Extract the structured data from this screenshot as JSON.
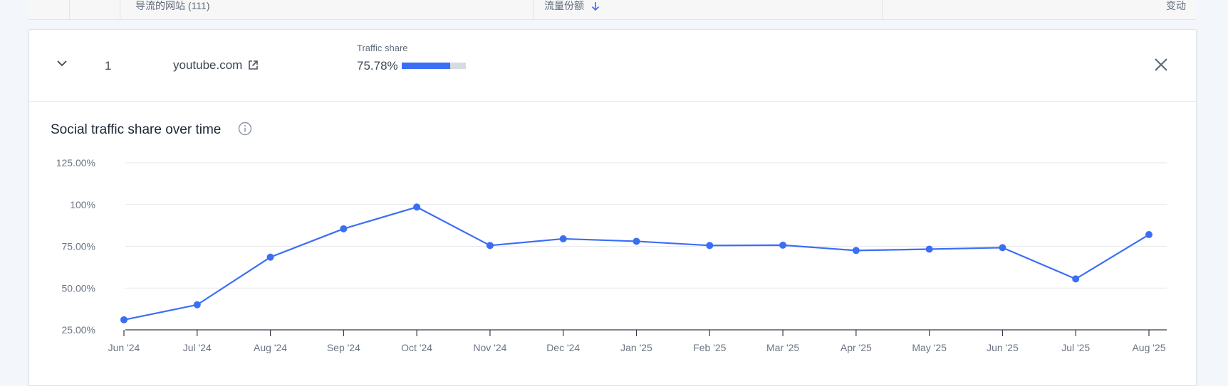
{
  "header": {
    "col_sites": "导流的网站 (111)",
    "col_share": "流量份额",
    "col_change": "变动"
  },
  "row": {
    "rank": "1",
    "domain": "youtube.com",
    "traffic_share_label": "Traffic share",
    "traffic_share_value": "75.78%",
    "traffic_share_fraction": 0.7578
  },
  "colors": {
    "accent": "#3b6ef6",
    "bar_track": "#d7dce3"
  },
  "chart_data": {
    "type": "line",
    "title": "Social traffic share over time",
    "categories": [
      "Jun '24",
      "Jul '24",
      "Aug '24",
      "Sep '24",
      "Oct '24",
      "Nov '24",
      "Dec '24",
      "Jan '25",
      "Feb '25",
      "Mar '25",
      "Apr '25",
      "May '25",
      "Jun '25",
      "Jul '25",
      "Aug '25"
    ],
    "values": [
      31,
      40,
      68.5,
      85.5,
      98.5,
      75.5,
      79.5,
      78,
      75.5,
      75.7,
      72.5,
      73.3,
      74.2,
      55.5,
      82
    ],
    "y_ticks": [
      25,
      50,
      75,
      100,
      125
    ],
    "y_tick_labels": [
      "25.00%",
      "50.00%",
      "75.00%",
      "100%",
      "125.00%"
    ],
    "ylim": [
      25,
      125
    ],
    "grid": true,
    "xlabel": "",
    "ylabel": ""
  }
}
